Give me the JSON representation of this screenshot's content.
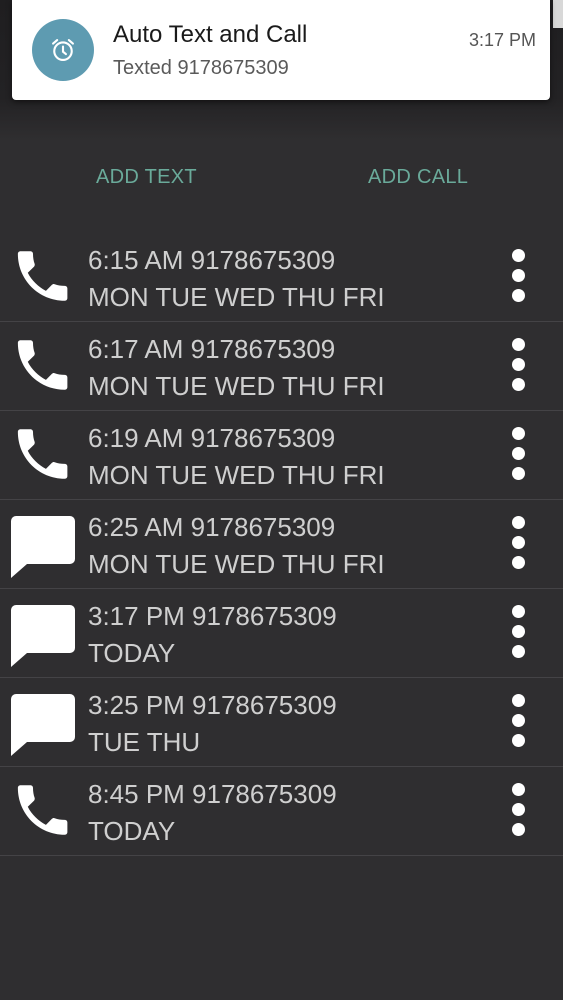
{
  "notification": {
    "app_name": "Auto Text and Call",
    "message": "Texted 9178675309",
    "time": "3:17 PM",
    "icon": "alarm-clock-icon",
    "icon_bg": "#5e9bb1"
  },
  "actions": {
    "add_text": "ADD TEXT",
    "add_call": "ADD CALL",
    "color": "#6aaa9a"
  },
  "schedules": [
    {
      "type": "call",
      "icon": "phone-icon",
      "line1": "6:15 AM 9178675309",
      "line2": "MON TUE WED THU FRI"
    },
    {
      "type": "call",
      "icon": "phone-icon",
      "line1": "6:17 AM 9178675309",
      "line2": "MON TUE WED THU FRI"
    },
    {
      "type": "call",
      "icon": "phone-icon",
      "line1": "6:19 AM 9178675309",
      "line2": "MON TUE WED THU FRI"
    },
    {
      "type": "text",
      "icon": "message-icon",
      "line1": "6:25 AM 9178675309",
      "line2": "MON TUE WED THU FRI"
    },
    {
      "type": "text",
      "icon": "message-icon",
      "line1": "3:17 PM 9178675309",
      "line2": "TODAY"
    },
    {
      "type": "text",
      "icon": "message-icon",
      "line1": "3:25 PM 9178675309",
      "line2": "TUE THU"
    },
    {
      "type": "call",
      "icon": "phone-icon",
      "line1": "8:45 PM 9178675309",
      "line2": "TODAY"
    }
  ]
}
